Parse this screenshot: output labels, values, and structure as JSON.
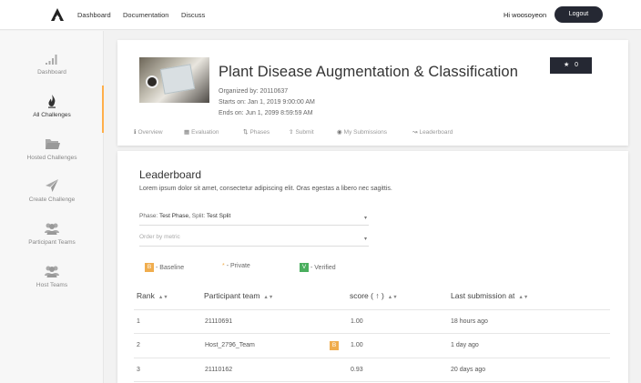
{
  "nav": {
    "links": [
      "Dashboard",
      "Documentation",
      "Discuss"
    ],
    "greeting": "Hi woosoyeon",
    "logout": "Logout"
  },
  "sidebar": {
    "items": [
      {
        "label": "Dashboard",
        "icon": "bar-chart-icon"
      },
      {
        "label": "All Challenges",
        "icon": "flame-icon",
        "active": true
      },
      {
        "label": "Hosted Challenges",
        "icon": "folder-icon"
      },
      {
        "label": "Create Challenge",
        "icon": "paper-plane-icon"
      },
      {
        "label": "Participant Teams",
        "icon": "users-icon"
      },
      {
        "label": "Host Teams",
        "icon": "users-icon"
      }
    ]
  },
  "challenge": {
    "title": "Plant Disease Augmentation & Classification",
    "organized_by": "Organized by: 20110637",
    "starts_on": "Starts on: Jan 1, 2019 9:00:00 AM",
    "ends_on": "Ends on: Jun 1, 2099 8:59:59 AM",
    "stars": "0",
    "tabs": [
      "Overview",
      "Evaluation",
      "Phases",
      "Submit",
      "My Submissions",
      "Leaderboard"
    ]
  },
  "leaderboard": {
    "title": "Leaderboard",
    "description": "Lorem ipsum dolor sit amet, consectetur adipiscing elit. Oras egestas a libero nec sagittis.",
    "phase_prefix": "Phase:",
    "phase_value": "Test Phase,",
    "split_prefix": "Split:",
    "split_value": "Test Split",
    "order_placeholder": "Order by metric",
    "legend": {
      "baseline_badge": "B",
      "baseline": "- Baseline",
      "private_mark": "*",
      "private": "- Private",
      "verified_badge": "V",
      "verified": "- Verified"
    },
    "headers": [
      "Rank",
      "Participant team",
      "score ( ↑ )",
      "Last submission at"
    ],
    "rows": [
      {
        "rank": "1",
        "team": "21110691",
        "baseline": false,
        "score": "1.00",
        "last": "18 hours ago"
      },
      {
        "rank": "2",
        "team": "Host_2796_Team",
        "baseline": true,
        "score": "1.00",
        "last": "1 day ago"
      },
      {
        "rank": "3",
        "team": "21110162",
        "baseline": false,
        "score": "0.93",
        "last": "20 days ago"
      }
    ]
  },
  "colors": {
    "dark": "#252833",
    "accent": "#ffaf4a",
    "baseline": "#f0ad4e",
    "verified": "#4aae5e"
  }
}
